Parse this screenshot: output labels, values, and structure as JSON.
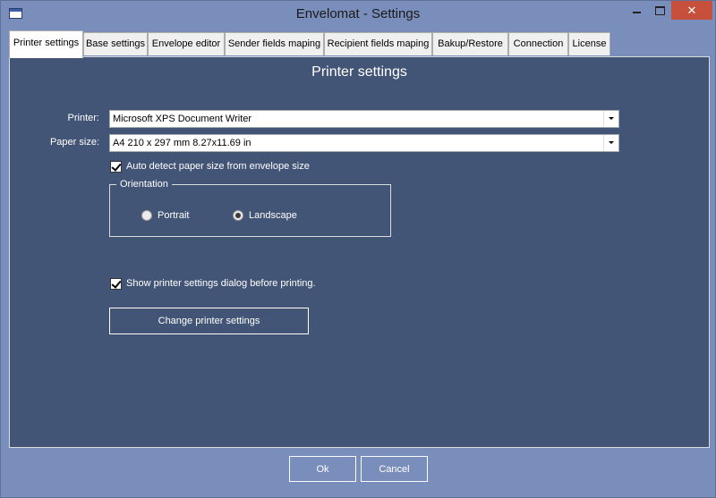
{
  "window": {
    "title": "Envelomat - Settings",
    "close_glyph": "✕"
  },
  "tabs": [
    {
      "label": "Printer settings",
      "active": true
    },
    {
      "label": "Base settings"
    },
    {
      "label": "Envelope editor"
    },
    {
      "label": "Sender fields maping"
    },
    {
      "label": "Recipient fields maping"
    },
    {
      "label": "Bakup/Restore"
    },
    {
      "label": "Connection"
    },
    {
      "label": "License"
    }
  ],
  "printer_page": {
    "title": "Printer settings",
    "printer": {
      "label": "Printer:",
      "value": "Microsoft XPS Document Writer"
    },
    "paper_size": {
      "label": "Paper size:",
      "value": "A4 210 x 297 mm 8.27x11.69 in"
    },
    "auto_detect": {
      "label": "Auto detect paper size from envelope size",
      "checked": true
    },
    "orientation": {
      "legend": "Orientation",
      "portrait": {
        "label": "Portrait",
        "checked": false
      },
      "landscape": {
        "label": "Landscape",
        "checked": true
      }
    },
    "show_dialog": {
      "label": "Show printer settings dialog before printing.",
      "checked": true
    },
    "change_button": "Change printer settings"
  },
  "footer": {
    "ok": "Ok",
    "cancel": "Cancel"
  },
  "colors": {
    "page_bg": "#435576",
    "window_bg": "#7a8ebb",
    "close_bg": "#c7503c"
  }
}
